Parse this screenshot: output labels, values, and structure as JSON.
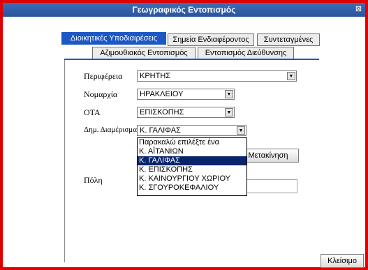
{
  "window": {
    "title": "Γεωγραφικός Εντοπισμός",
    "close_glyph": "⊠"
  },
  "tabs": [
    {
      "label": "Διοικητικές Υποδιαιρέσεις",
      "active": true
    },
    {
      "label": "Σημεία Ενδιαφέροντος",
      "active": false
    },
    {
      "label": "Συντεταγμένες",
      "active": false
    },
    {
      "label": "Αζιμουθιακός Εντοπισμός",
      "active": false
    },
    {
      "label": "Εντοπισμός Διεύθυνσης",
      "active": false
    }
  ],
  "form": {
    "region_label": "Περιφέρεια",
    "region_value": "ΚΡΗΤΗΣ",
    "prefecture_label": "Νομαρχία",
    "prefecture_value": "ΗΡΑΚΛΕΙΟΥ",
    "ota_label": "ΟΤΑ",
    "ota_value": "ΕΠΙΣΚΟΠΗΣ",
    "district_label": "Δημ. Διαμέρισμα",
    "district_value": "Κ. ΓΑΛΙΦΑΣ",
    "city_label": "Πόλη",
    "city_value": ""
  },
  "dropdown": {
    "options": [
      "Παρακαλώ επιλέξτε ένα",
      "Κ. ΑΪΤΑΝΙΩΝ",
      "Κ. ΓΑΛΙΦΑΣ",
      "Κ. ΕΠΙΣΚΟΠΗΣ",
      "Κ. ΚΑΙΝΟΥΡΓΙΟΥ ΧΩΡΙΟΥ",
      "Κ. ΣΓΟΥΡΟΚΕΦΑΛΙΟΥ"
    ],
    "selected_index": 2
  },
  "buttons": {
    "move": "Μετακίνηση",
    "close": "Κλείσιμο"
  },
  "colors": {
    "frame": "#e00000",
    "titlebar": "#2f5ea8",
    "active_tab": "#1c57c4",
    "selected_option": "#0a246a"
  },
  "icons": {
    "close": "close-icon",
    "dropdown": "chevron-down-icon"
  }
}
